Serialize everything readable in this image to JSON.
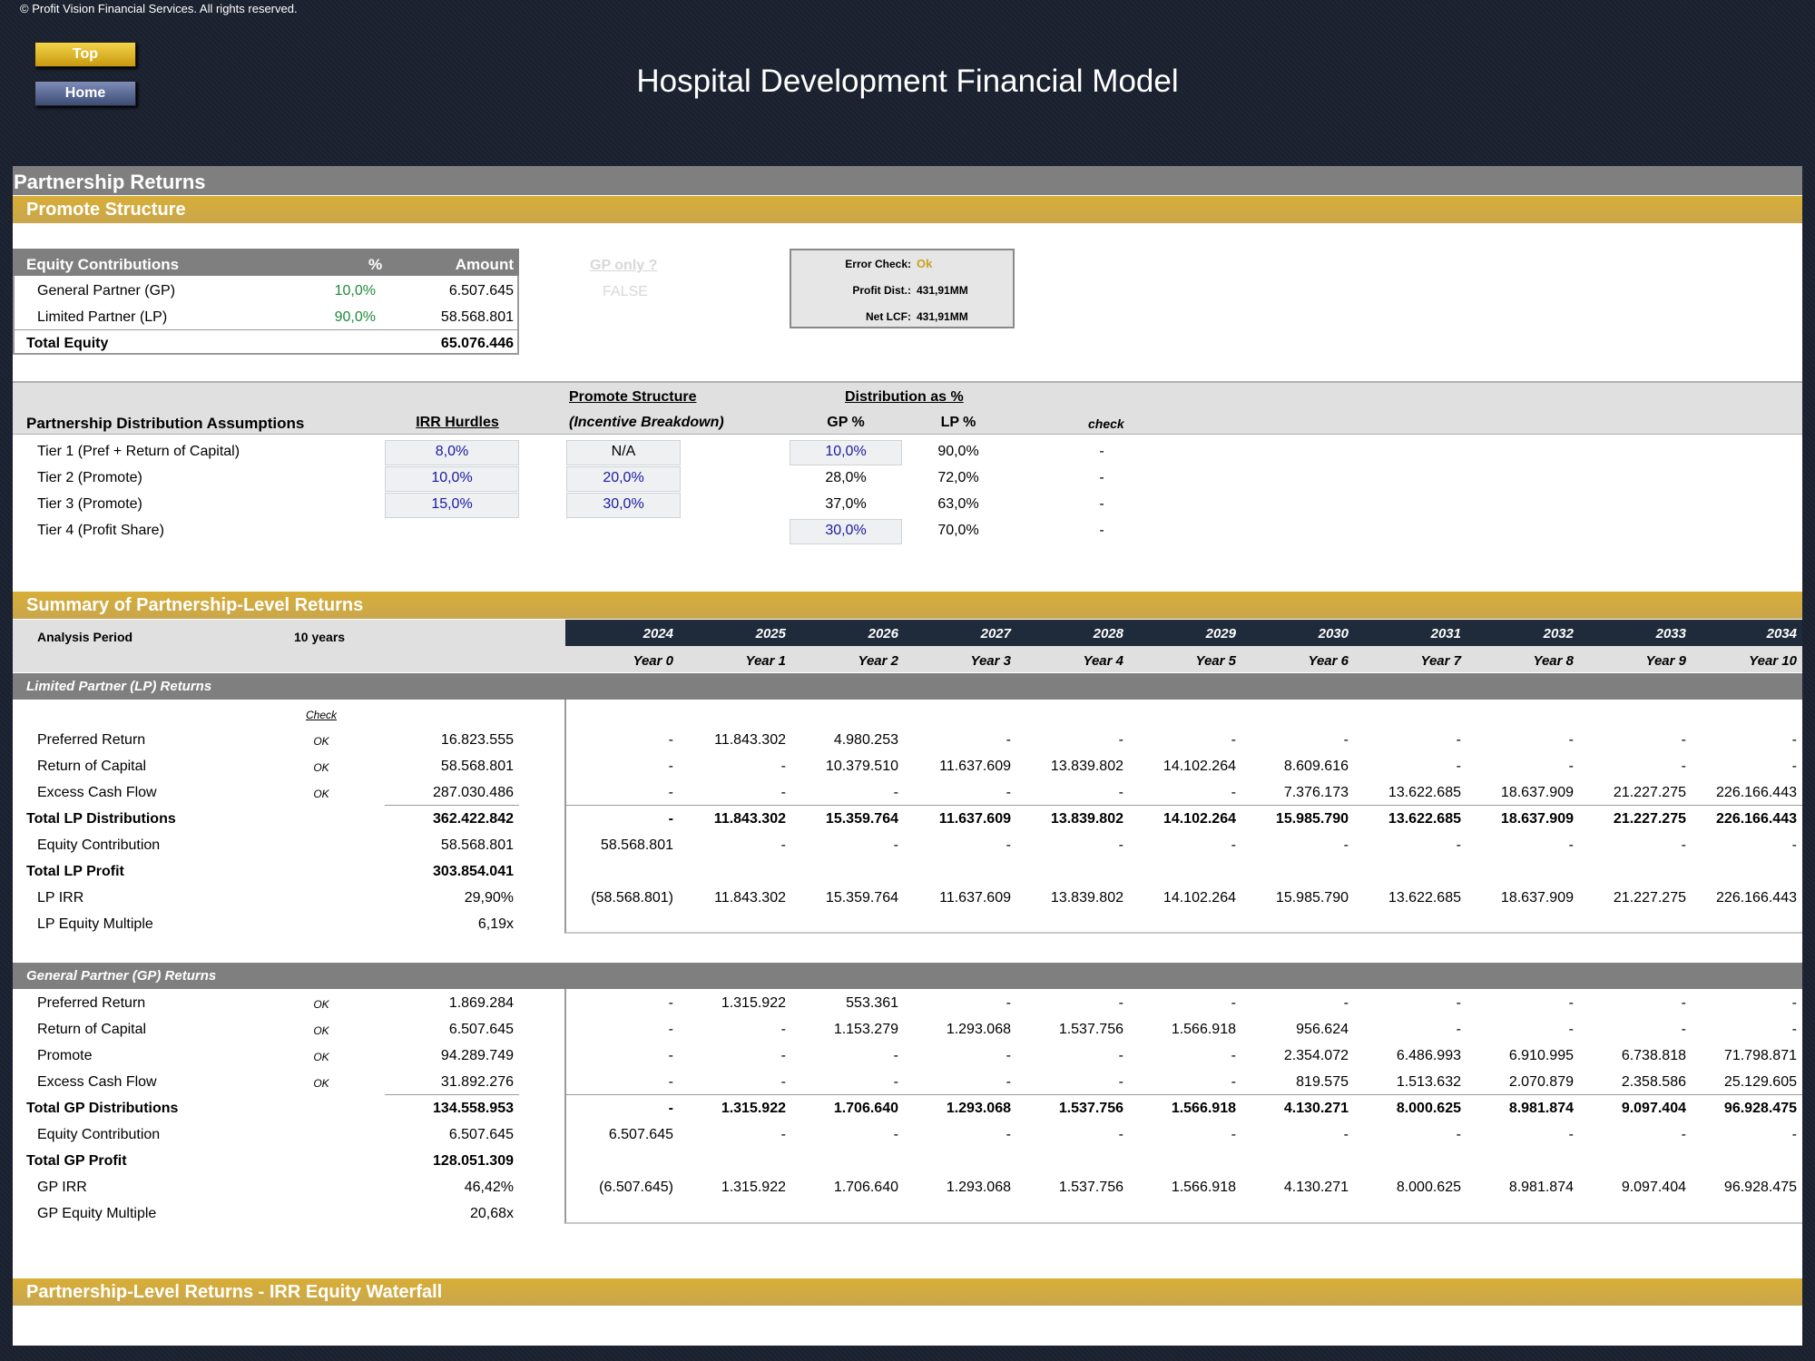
{
  "header": {
    "copyright": "© Profit Vision Financial Services. All rights reserved.",
    "title": "Hospital Development Financial Model",
    "top_button": "Top",
    "home_button": "Home"
  },
  "section": {
    "title": "Partnership Returns",
    "promote_title": "Promote Structure",
    "summary_title": "Summary of Partnership-Level Returns",
    "waterfall_title": "Partnership-Level Returns - IRR Equity Waterfall"
  },
  "equity": {
    "heading": "Equity Contributions",
    "pct_hdr": "%",
    "amount_hdr": "Amount",
    "gp_label": "General Partner (GP)",
    "gp_pct": "10,0%",
    "gp_amount": "6.507.645",
    "lp_label": "Limited Partner (LP)",
    "lp_pct": "90,0%",
    "lp_amount": "58.568.801",
    "total_label": "Total Equity",
    "total_amount": "65.076.446",
    "gp_only_label": "GP only ?",
    "gp_only_value": "FALSE"
  },
  "check_box": {
    "error_label": "Error Check:",
    "error_value": "Ok",
    "profit_label": "Profit Dist.:",
    "profit_value": "431,91MM",
    "netlcf_label": "Net LCF:",
    "netlcf_value": "431,91MM"
  },
  "assumptions": {
    "heading": "Partnership Distribution Assumptions",
    "irr_hdr": "IRR Hurdles",
    "promote_hdr1": "Promote Structure",
    "promote_hdr2": "(Incentive Breakdown)",
    "dist_hdr": "Distribution as %",
    "gp_hdr": "GP %",
    "lp_hdr": "LP %",
    "check_hdr": "check",
    "tiers": [
      {
        "label": "Tier 1 (Pref + Return of Capital)",
        "irr": "8,0%",
        "promote": "N/A",
        "gp": "10,0%",
        "lp": "90,0%",
        "check": "-"
      },
      {
        "label": "Tier 2 (Promote)",
        "irr": "10,0%",
        "promote": "20,0%",
        "gp": "28,0%",
        "lp": "72,0%",
        "check": "-"
      },
      {
        "label": "Tier 3 (Promote)",
        "irr": "15,0%",
        "promote": "30,0%",
        "gp": "37,0%",
        "lp": "63,0%",
        "check": "-"
      },
      {
        "label": "Tier 4 (Profit Share)",
        "irr": "",
        "promote": "",
        "gp": "30,0%",
        "lp": "70,0%",
        "check": "-"
      }
    ]
  },
  "summary": {
    "analysis_label": "Analysis Period",
    "analysis_value": "10 years",
    "years": [
      "2024",
      "2025",
      "2026",
      "2027",
      "2028",
      "2029",
      "2030",
      "2031",
      "2032",
      "2033",
      "2034"
    ],
    "year_labels": [
      "Year 0",
      "Year 1",
      "Year 2",
      "Year 3",
      "Year 4",
      "Year 5",
      "Year 6",
      "Year 7",
      "Year 8",
      "Year 9",
      "Year 10"
    ],
    "check_hdr": "Check",
    "lp_title": "Limited Partner (LP) Returns",
    "lp_rows": [
      {
        "label": "Preferred Return",
        "check": "OK",
        "total": "16.823.555",
        "vals": [
          "-",
          "11.843.302",
          "4.980.253",
          "-",
          "-",
          "-",
          "-",
          "-",
          "-",
          "-",
          "-"
        ],
        "bold": false
      },
      {
        "label": "Return of Capital",
        "check": "OK",
        "total": "58.568.801",
        "vals": [
          "-",
          "-",
          "10.379.510",
          "11.637.609",
          "13.839.802",
          "14.102.264",
          "8.609.616",
          "-",
          "-",
          "-",
          "-"
        ],
        "bold": false
      },
      {
        "label": "Excess Cash Flow",
        "check": "OK",
        "total": "287.030.486",
        "vals": [
          "-",
          "-",
          "-",
          "-",
          "-",
          "-",
          "7.376.173",
          "13.622.685",
          "18.637.909",
          "21.227.275",
          "226.166.443"
        ],
        "bold": false
      },
      {
        "label": "Total LP Distributions",
        "check": "",
        "total": "362.422.842",
        "vals": [
          "-",
          "11.843.302",
          "15.359.764",
          "11.637.609",
          "13.839.802",
          "14.102.264",
          "15.985.790",
          "13.622.685",
          "18.637.909",
          "21.227.275",
          "226.166.443"
        ],
        "bold": true
      },
      {
        "label": "Equity Contribution",
        "check": "",
        "total": "58.568.801",
        "vals": [
          "58.568.801",
          "-",
          "-",
          "-",
          "-",
          "-",
          "-",
          "-",
          "-",
          "-",
          "-"
        ],
        "bold": false
      },
      {
        "label": "Total LP Profit",
        "check": "",
        "total": "303.854.041",
        "vals": [
          "",
          "",
          "",
          "",
          "",
          "",
          "",
          "",
          "",
          "",
          ""
        ],
        "bold": true
      },
      {
        "label": "LP IRR",
        "check": "",
        "total": "29,90%",
        "vals": [
          "(58.568.801)",
          "11.843.302",
          "15.359.764",
          "11.637.609",
          "13.839.802",
          "14.102.264",
          "15.985.790",
          "13.622.685",
          "18.637.909",
          "21.227.275",
          "226.166.443"
        ],
        "bold": false
      },
      {
        "label": "LP Equity Multiple",
        "check": "",
        "total": "6,19x",
        "vals": [
          "",
          "",
          "",
          "",
          "",
          "",
          "",
          "",
          "",
          "",
          ""
        ],
        "bold": false
      }
    ],
    "gp_title": "General Partner (GP) Returns",
    "gp_rows": [
      {
        "label": "Preferred Return",
        "check": "OK",
        "total": "1.869.284",
        "vals": [
          "-",
          "1.315.922",
          "553.361",
          "-",
          "-",
          "-",
          "-",
          "-",
          "-",
          "-",
          "-"
        ],
        "bold": false
      },
      {
        "label": "Return of Capital",
        "check": "OK",
        "total": "6.507.645",
        "vals": [
          "-",
          "-",
          "1.153.279",
          "1.293.068",
          "1.537.756",
          "1.566.918",
          "956.624",
          "-",
          "-",
          "-",
          "-"
        ],
        "bold": false
      },
      {
        "label": "Promote",
        "check": "OK",
        "total": "94.289.749",
        "vals": [
          "-",
          "-",
          "-",
          "-",
          "-",
          "-",
          "2.354.072",
          "6.486.993",
          "6.910.995",
          "6.738.818",
          "71.798.871"
        ],
        "bold": false
      },
      {
        "label": "Excess Cash Flow",
        "check": "OK",
        "total": "31.892.276",
        "vals": [
          "-",
          "-",
          "-",
          "-",
          "-",
          "-",
          "819.575",
          "1.513.632",
          "2.070.879",
          "2.358.586",
          "25.129.605"
        ],
        "bold": false
      },
      {
        "label": "Total GP Distributions",
        "check": "",
        "total": "134.558.953",
        "vals": [
          "-",
          "1.315.922",
          "1.706.640",
          "1.293.068",
          "1.537.756",
          "1.566.918",
          "4.130.271",
          "8.000.625",
          "8.981.874",
          "9.097.404",
          "96.928.475"
        ],
        "bold": true
      },
      {
        "label": "Equity Contribution",
        "check": "",
        "total": "6.507.645",
        "vals": [
          "6.507.645",
          "-",
          "-",
          "-",
          "-",
          "-",
          "-",
          "-",
          "-",
          "-",
          "-"
        ],
        "bold": false
      },
      {
        "label": "Total GP Profit",
        "check": "",
        "total": "128.051.309",
        "vals": [
          "",
          "",
          "",
          "",
          "",
          "",
          "",
          "",
          "",
          "",
          ""
        ],
        "bold": true
      },
      {
        "label": "GP IRR",
        "check": "",
        "total": "46,42%",
        "vals": [
          "(6.507.645)",
          "1.315.922",
          "1.706.640",
          "1.293.068",
          "1.537.756",
          "1.566.918",
          "4.130.271",
          "8.000.625",
          "8.981.874",
          "9.097.404",
          "96.928.475"
        ],
        "bold": false
      },
      {
        "label": "GP Equity Multiple",
        "check": "",
        "total": "20,68x",
        "vals": [
          "",
          "",
          "",
          "",
          "",
          "",
          "",
          "",
          "",
          "",
          ""
        ],
        "bold": false
      }
    ]
  }
}
